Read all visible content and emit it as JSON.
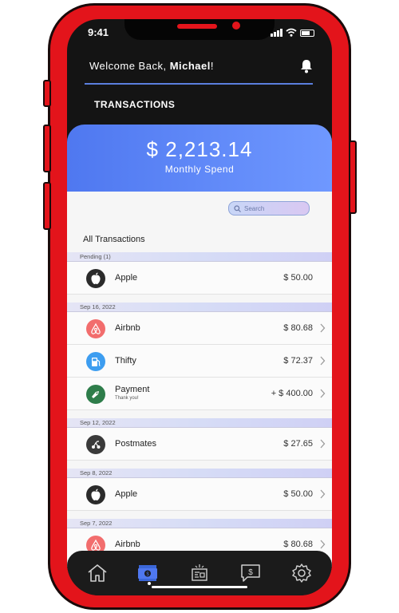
{
  "status": {
    "time": "9:41"
  },
  "header": {
    "welcome_prefix": "Welcome Back, ",
    "user_name": "Michael",
    "welcome_suffix": "!",
    "section_title": "TRANSACTIONS"
  },
  "summary": {
    "amount": "$ 2,213.14",
    "label": "Monthly Spend"
  },
  "search": {
    "placeholder": "Search"
  },
  "list_title": "All Transactions",
  "groups": [
    {
      "label": "Pending (1)",
      "items": [
        {
          "name": "Apple",
          "amount": "$ 50.00",
          "icon": "apple-icon",
          "color": "#2b2b2b",
          "chevron": false
        }
      ]
    },
    {
      "label": "Sep 16, 2022",
      "items": [
        {
          "name": "Airbnb",
          "amount": "$ 80.68",
          "icon": "airbnb-icon",
          "color": "#f26d6d",
          "chevron": true
        },
        {
          "name": "Thifty",
          "amount": "$ 72.37",
          "icon": "gas-pump-icon",
          "color": "#3d9df0",
          "chevron": true
        },
        {
          "name": "Payment",
          "sub": "Thank you!",
          "amount": "+ $ 400.00",
          "icon": "payment-icon",
          "color": "#2e7d4a",
          "chevron": true
        }
      ]
    },
    {
      "label": "Sep 12, 2022",
      "items": [
        {
          "name": "Postmates",
          "amount": "$ 27.65",
          "icon": "postmates-icon",
          "color": "#3a3a3a",
          "chevron": true
        }
      ]
    },
    {
      "label": "Sep 8, 2022",
      "items": [
        {
          "name": "Apple",
          "amount": "$ 50.00",
          "icon": "apple-icon",
          "color": "#2b2b2b",
          "chevron": true
        }
      ]
    },
    {
      "label": "Sep 7, 2022",
      "items": [
        {
          "name": "Airbnb",
          "amount": "$ 80.68",
          "icon": "airbnb-icon",
          "color": "#f26d6d",
          "chevron": true
        }
      ]
    }
  ],
  "tabs": [
    {
      "name": "home-icon"
    },
    {
      "name": "money-icon",
      "active": true
    },
    {
      "name": "bills-icon"
    },
    {
      "name": "chat-icon"
    },
    {
      "name": "settings-icon"
    }
  ],
  "colors": {
    "accent": "#4f78f0",
    "frame": "#e3141b"
  }
}
